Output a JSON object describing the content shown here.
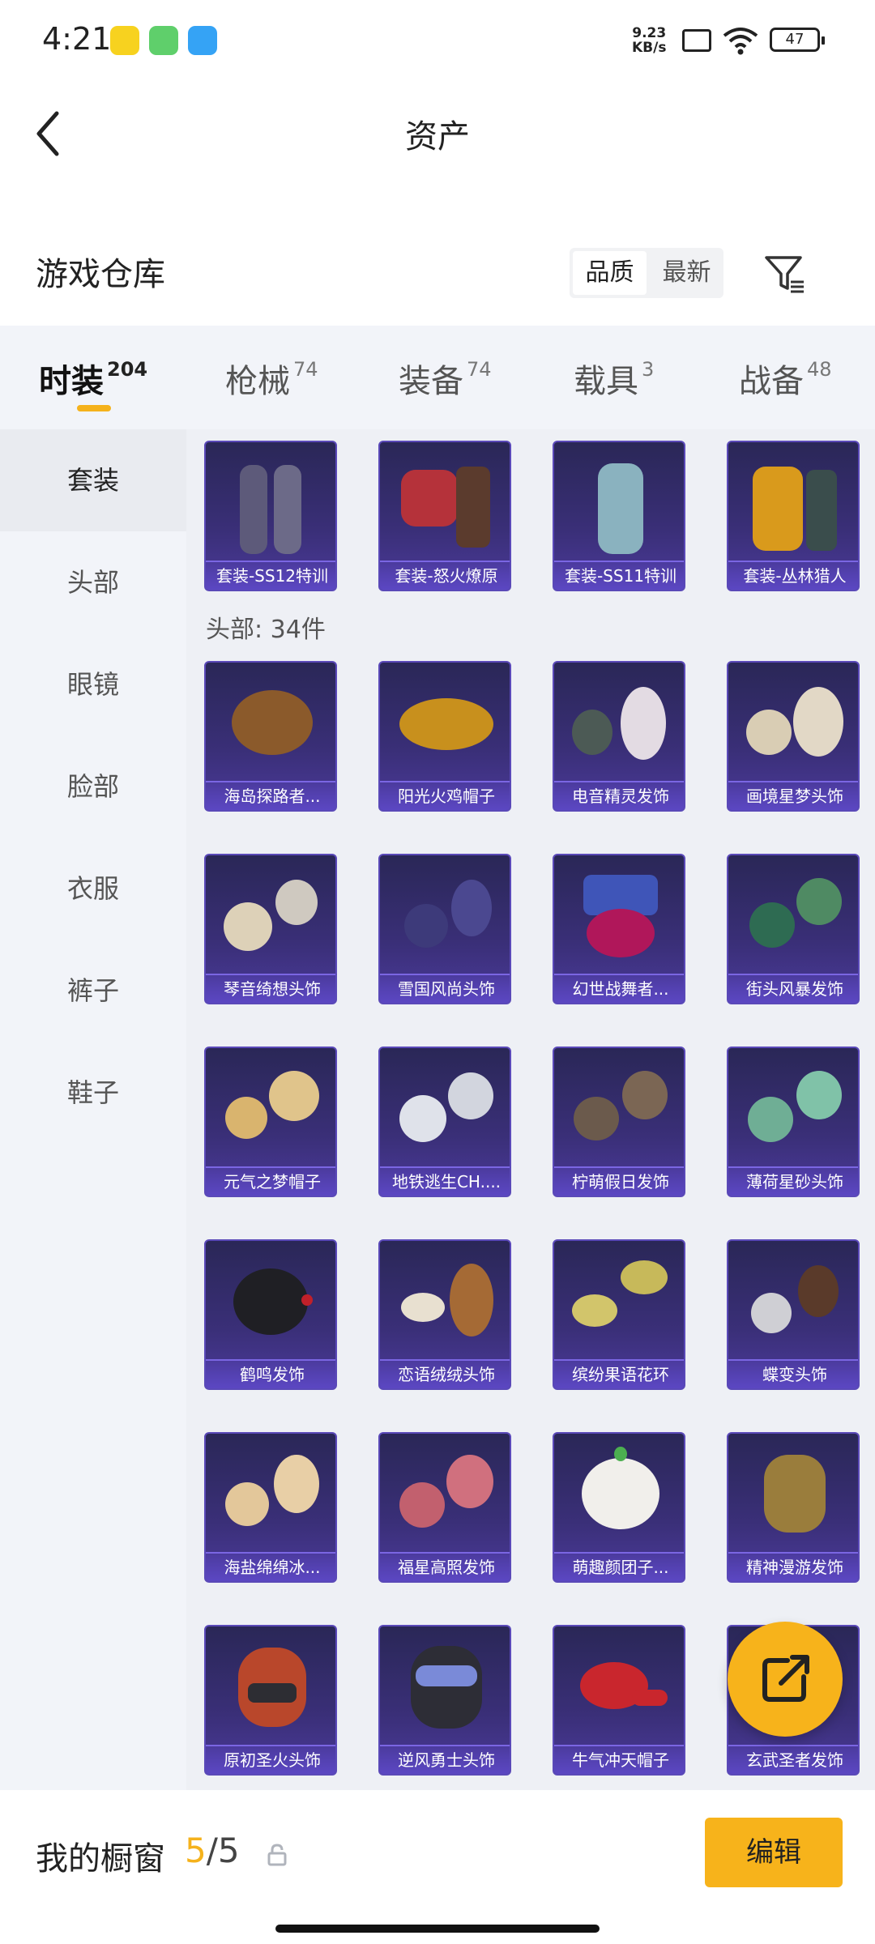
{
  "status_bar": {
    "time": "4:21",
    "speed_value": "9.23",
    "speed_unit": "KB/s",
    "battery": "47"
  },
  "header": {
    "title": "资产"
  },
  "warehouse": {
    "title": "游戏仓库",
    "sort_quality": "品质",
    "sort_newest": "最新"
  },
  "tabs": [
    {
      "label": "时装",
      "count": "204"
    },
    {
      "label": "枪械",
      "count": "74"
    },
    {
      "label": "装备",
      "count": "74"
    },
    {
      "label": "载具",
      "count": "3"
    },
    {
      "label": "战备",
      "count": "48"
    }
  ],
  "sidebar": {
    "items": [
      {
        "label": "套装"
      },
      {
        "label": "头部"
      },
      {
        "label": "眼镜"
      },
      {
        "label": "脸部"
      },
      {
        "label": "衣服"
      },
      {
        "label": "裤子"
      },
      {
        "label": "鞋子"
      }
    ]
  },
  "outfits": [
    {
      "label": "套装-SS12特训"
    },
    {
      "label": "套装-怒火燎原"
    },
    {
      "label": "套装-SS11特训"
    },
    {
      "label": "套装-丛林猎人"
    }
  ],
  "head_section": {
    "label": "头部: 34件"
  },
  "head_items": [
    {
      "label": "海岛探路者..."
    },
    {
      "label": "阳光火鸡帽子"
    },
    {
      "label": "电音精灵发饰"
    },
    {
      "label": "画境星梦头饰"
    },
    {
      "label": "琴音绮想头饰"
    },
    {
      "label": "雪国风尚头饰"
    },
    {
      "label": "幻世战舞者..."
    },
    {
      "label": "街头风暴发饰"
    },
    {
      "label": "元气之梦帽子"
    },
    {
      "label": "地铁逃生CH...."
    },
    {
      "label": "柠萌假日发饰"
    },
    {
      "label": "薄荷星砂头饰"
    },
    {
      "label": "鹤鸣发饰"
    },
    {
      "label": "恋语绒绒头饰"
    },
    {
      "label": "缤纷果语花环"
    },
    {
      "label": "蝶变头饰"
    },
    {
      "label": "海盐绵绵冰..."
    },
    {
      "label": "福星高照发饰"
    },
    {
      "label": "萌趣颜团子..."
    },
    {
      "label": "精神漫游发饰"
    },
    {
      "label": "原初圣火头饰"
    },
    {
      "label": "逆风勇士头饰"
    },
    {
      "label": "牛气冲天帽子"
    },
    {
      "label": "玄武圣者发饰"
    }
  ],
  "showcase": {
    "label": "我的橱窗",
    "current": "5",
    "separator": "/",
    "total": "5",
    "edit_label": "编辑"
  },
  "colors": {
    "accent": "#f7b31b",
    "card_bg": "#3a2f78"
  }
}
